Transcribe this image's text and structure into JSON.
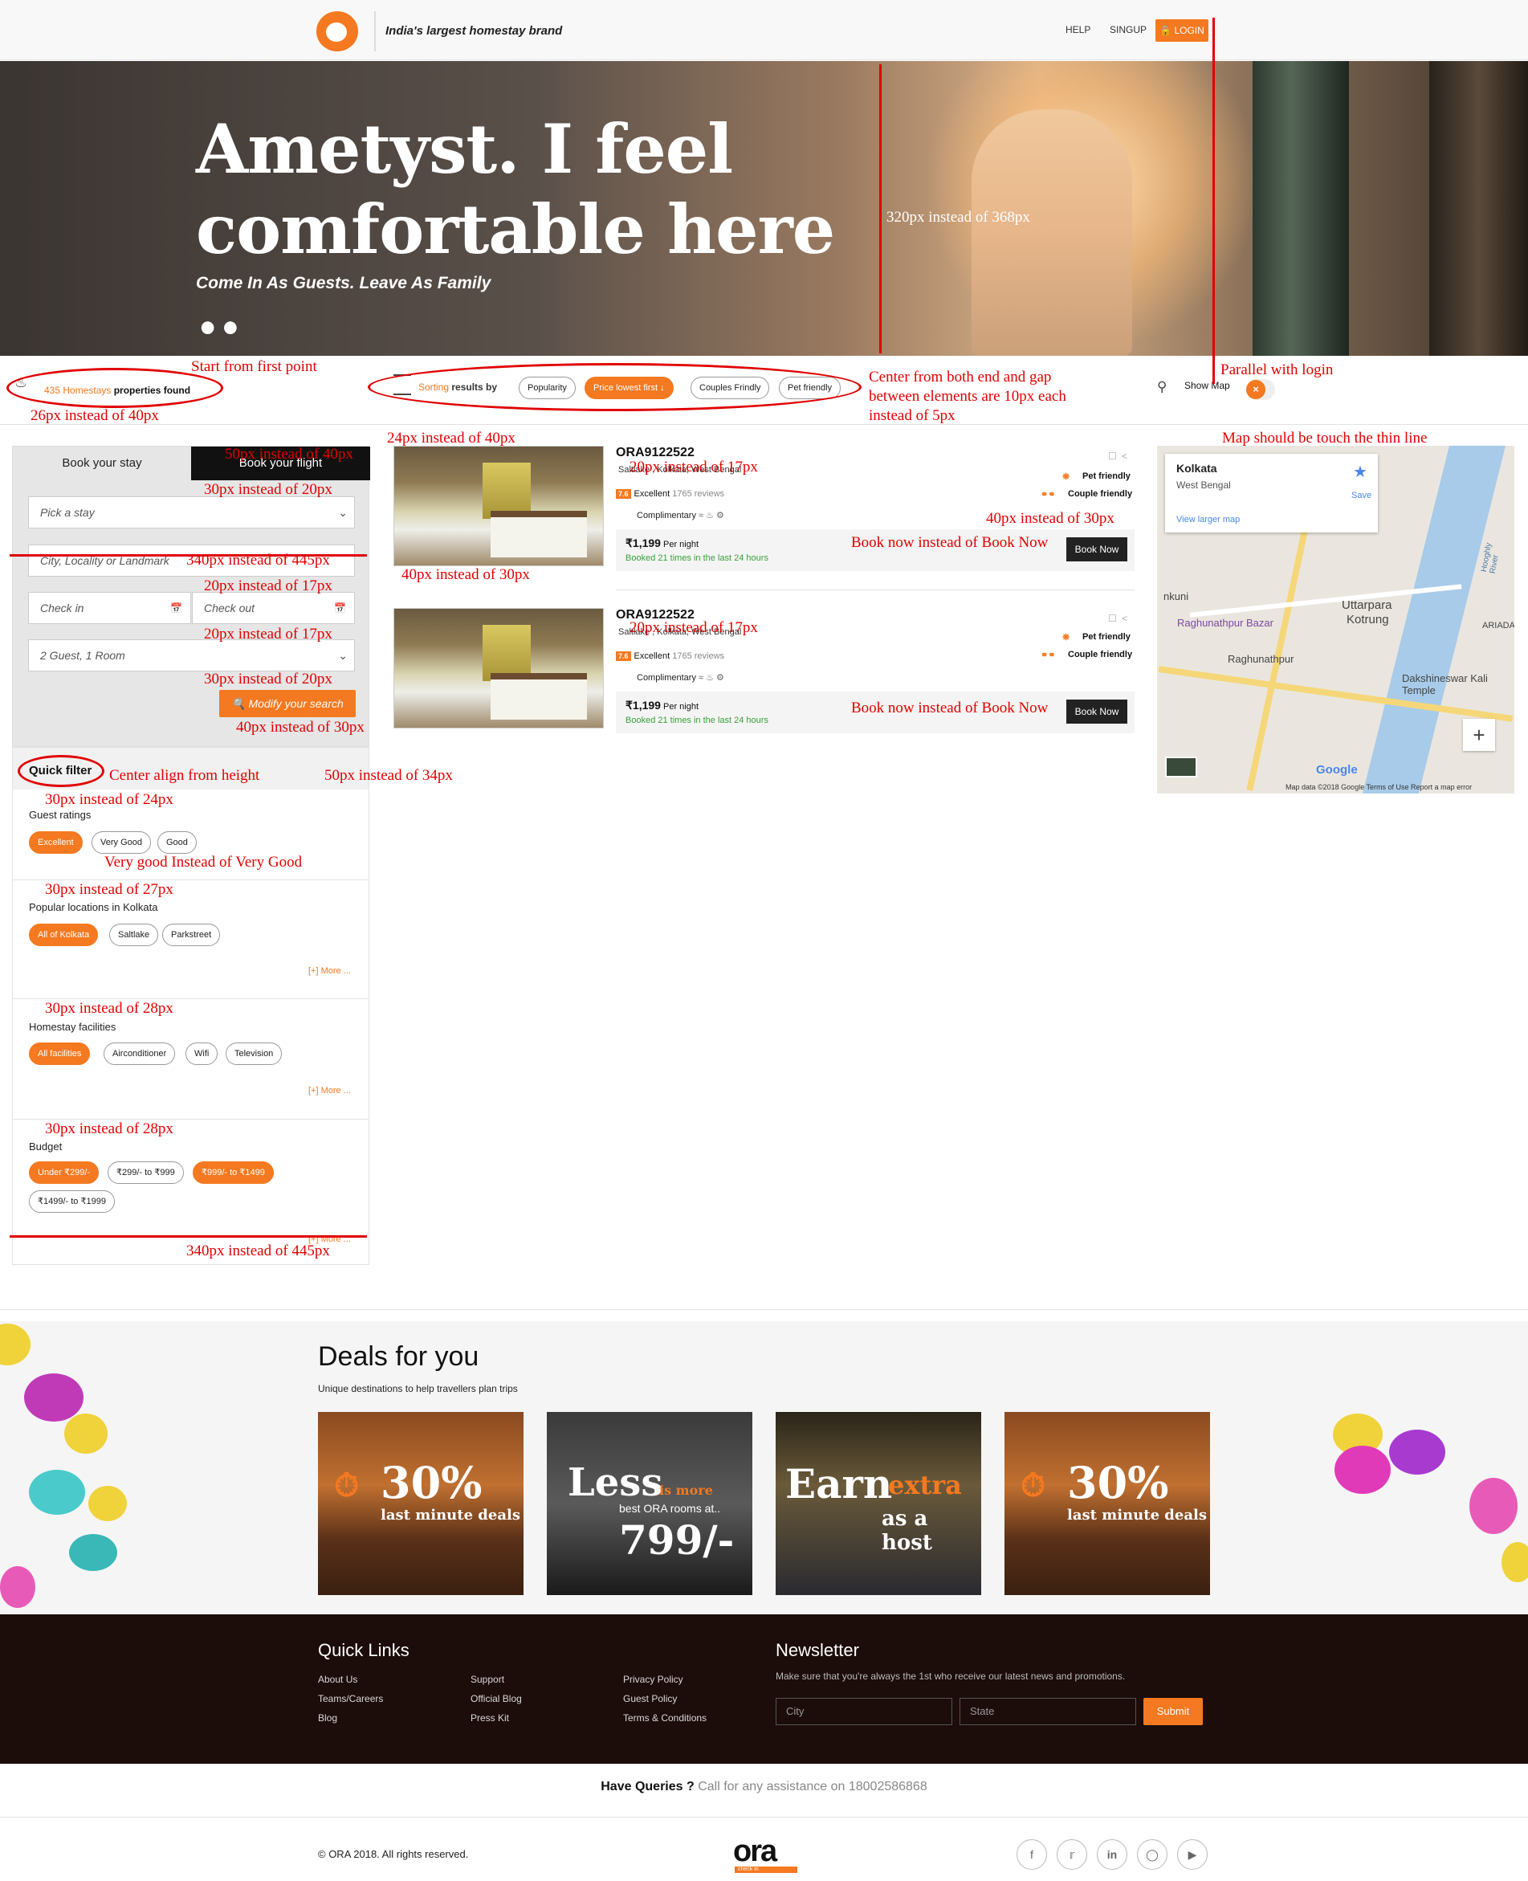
{
  "header": {
    "tagline": "India's largest homestay brand",
    "help": "HELP",
    "signup": "SINGUP",
    "login": "LOGIN"
  },
  "hero": {
    "title": "Ametyst. I feel comfortable here ..",
    "subtitle": "Come In As Guests. Leave As Family"
  },
  "results": {
    "count": "435 Homestays",
    "suffix": " properties found"
  },
  "sort": {
    "label_a": "Sorting",
    "label_b": " results by",
    "options": [
      "Popularity",
      "Price lowest first  ↓",
      "Couples Frindly",
      "Pet friendly"
    ],
    "active_index": 1
  },
  "map_toggle": {
    "label": "Show Map"
  },
  "booking": {
    "tab_stay": "Book your stay",
    "tab_flight": "Book your flight",
    "pick": "Pick a stay",
    "city": "City, Locality or Landmark",
    "checkin": "Check in",
    "checkout": "Check out",
    "guests": "2 Guest, 1 Room",
    "modify": "Modify your search"
  },
  "filters": {
    "heading": "Quick filter",
    "ratings": {
      "title": "Guest ratings",
      "options": [
        "Excellent",
        "Very Good",
        "Good"
      ]
    },
    "locations": {
      "title": "Popular locations in Kolkata",
      "options": [
        "All of Kolkata",
        "Saltlake",
        "Parkstreet"
      ],
      "more": "[+] More ..."
    },
    "facilities": {
      "title": "Homestay facilities",
      "options": [
        "All facilities",
        "Airconditioner",
        "Wifi",
        "Television"
      ],
      "more": "[+] More ..."
    },
    "budget": {
      "title": "Budget",
      "options": [
        "Under ₹299/-",
        "₹299/- to ₹999",
        "₹999/- to ₹1499",
        "₹1499/- to ₹1999"
      ],
      "more": "[+] More ..."
    }
  },
  "listings": [
    {
      "name": "ORA9122522",
      "location": "Saltlake , Kolkata, West Bengal",
      "score": "7.6",
      "rating": "Excellent",
      "reviews": "1765 reviews",
      "complimentary": "Complimentary",
      "tag1": "Pet friendly",
      "tag2": "Couple friendly",
      "price": "₹1,199",
      "per": " Per night",
      "booked": "Booked 21 times in the last 24 hours",
      "cta": "Book Now"
    },
    {
      "name": "ORA9122522",
      "location": "Saltlake , Kolkata, West Bengal",
      "score": "7.6",
      "rating": "Excellent",
      "reviews": "1765 reviews",
      "complimentary": "Complimentary",
      "tag1": "Pet friendly",
      "tag2": "Couple friendly",
      "price": "₹1,199",
      "per": " Per night",
      "booked": "Booked 21 times in the last 24 hours",
      "cta": "Book Now"
    }
  ],
  "map": {
    "place": "Kolkata",
    "region": "West Bengal",
    "save": "Save",
    "larger": "View larger map",
    "labels": [
      "Uttarpara",
      "Kotrung",
      "Raghunathpur Bazar",
      "Raghunathpur",
      "Dakshineswar Kali Temple",
      "ARIADA",
      "Hooghly River",
      "nkuni"
    ],
    "footer": "Map data ©2018 Google   Terms of Use   Report a map error",
    "google": "Google"
  },
  "deals": {
    "heading": "Deals for you",
    "sub": "Unique destinations to help travellers plan trips",
    "cards": [
      {
        "big": "30%",
        "small": "last minute deals"
      },
      {
        "big": "Less",
        "accent": "is more",
        "line": "best ORA rooms at..",
        "price": "799/-"
      },
      {
        "big": "Earn",
        "accent": "extra",
        "line": "as a host"
      },
      {
        "big": "30%",
        "small": "last minute deals"
      }
    ]
  },
  "footer": {
    "quick_links": "Quick Links",
    "col1": [
      "About Us",
      "Teams/Careers",
      "Blog"
    ],
    "col2": [
      "Support",
      "Official Blog",
      "Press Kit"
    ],
    "col3": [
      "Privacy Policy",
      "Guest Policy",
      "Terms & Conditions"
    ],
    "newsletter": "Newsletter",
    "news_sub": "Make sure that you're always the 1st who receive our latest news and promotions.",
    "city": "City",
    "state": "State",
    "submit": "Submit"
  },
  "queries": {
    "lead": "Have Queries ?",
    "rest": " Call for any assistance on 18002586868"
  },
  "bottom": {
    "copyright": "© ORA 2018. All rights reserved.",
    "logo": "ora",
    "logo_sub": "check in"
  },
  "annotations": {
    "a1": "Start from first point",
    "a2": "26px instead of 40px",
    "a3": "24px instead of 40px",
    "a4": "Center from both end and gap",
    "a5": "between elements are 10px each",
    "a6": "instead of 5px",
    "a7": "Parallel with login",
    "a8": "Map should be touch the thin line",
    "a9": "320px instead of 368px",
    "a10": "50px instead of 40px",
    "a11": "30px instead of 20px",
    "a12": "340px instead of 445px",
    "a13": "20px instead of 17px",
    "a14": "20px instead of 17px",
    "a15": "30px instead of 20px",
    "a16": "40px instead of 30px",
    "a17": "40px instead of 30px",
    "a18": "20px instead of 17px",
    "a19": "20px instead of 17px",
    "a20": "40px instead of 30px",
    "a21": "Book now instead of Book Now",
    "a22": "Book now instead of Book Now",
    "a23": "Center align from height",
    "a24": "50px instead of 34px",
    "a25": "30px instead of 24px",
    "a26": "Very good Instead of Very Good",
    "a27": "30px instead of 27px",
    "a28": "30px instead of 28px",
    "a29": "30px instead of 28px",
    "a30": "340px instead of 445px"
  }
}
